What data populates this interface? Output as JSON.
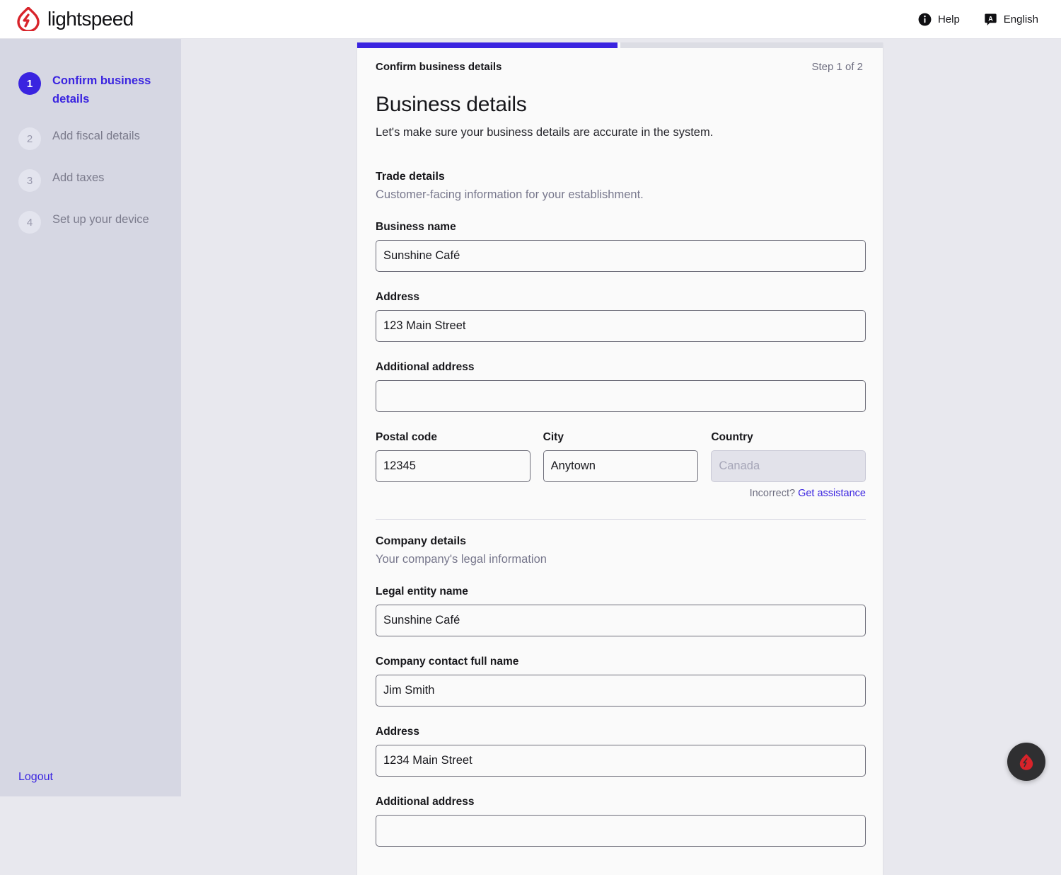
{
  "header": {
    "brand_name": "lightspeed",
    "brand_icon": "lightspeed-flame-icon",
    "help_label": "Help",
    "help_icon": "info-icon",
    "language_label": "English",
    "language_icon": "translate-icon"
  },
  "sidebar": {
    "steps": [
      {
        "number": "1",
        "label": "Confirm business details",
        "state": "active"
      },
      {
        "number": "2",
        "label": "Add fiscal details",
        "state": "idle"
      },
      {
        "number": "3",
        "label": "Add taxes",
        "state": "idle"
      },
      {
        "number": "4",
        "label": "Set up your device",
        "state": "idle"
      }
    ],
    "logout_label": "Logout"
  },
  "card": {
    "progress_percent": "50",
    "breadcrumb": "Confirm business details",
    "step_indicator": "Step 1 of 2",
    "title": "Business details",
    "lede": "Let's make sure your business details are accurate in the system.",
    "trade": {
      "title": "Trade details",
      "subtitle": "Customer-facing information for your establishment.",
      "business_name": {
        "label": "Business name",
        "value": "Sunshine Café",
        "placeholder": ""
      },
      "address": {
        "label": "Address",
        "value": "123 Main Street",
        "placeholder": ""
      },
      "additional_address": {
        "label": "Additional address",
        "value": "",
        "placeholder": ""
      },
      "postal_code": {
        "label": "Postal code",
        "value": "12345",
        "placeholder": ""
      },
      "city": {
        "label": "City",
        "value": "Anytown",
        "placeholder": ""
      },
      "country": {
        "label": "Country",
        "value": "",
        "placeholder": "Canada",
        "disabled": true
      },
      "assist_prefix": "Incorrect?",
      "assist_link": "Get assistance"
    },
    "company": {
      "title": "Company details",
      "subtitle": "Your company's legal information",
      "legal_entity_name": {
        "label": "Legal entity name",
        "value": "Sunshine Café",
        "placeholder": ""
      },
      "contact_full_name": {
        "label": "Company contact full name",
        "value": "Jim Smith",
        "placeholder": ""
      },
      "address": {
        "label": "Address",
        "value": "1234 Main Street",
        "placeholder": ""
      },
      "additional_address": {
        "label": "Additional address",
        "value": "",
        "placeholder": ""
      }
    }
  },
  "fab": {
    "icon": "lightspeed-flame-icon"
  },
  "colors": {
    "accent": "#3a24e0",
    "brand_red": "#d8232a",
    "page_background": "#e8e8ee",
    "sidebar_background": "#d6d7e3",
    "card_background": "#fafafa"
  }
}
